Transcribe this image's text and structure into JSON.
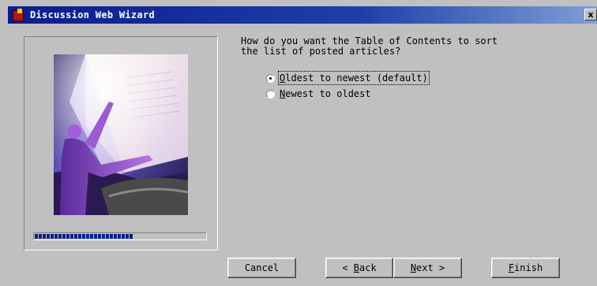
{
  "window": {
    "title": "Discussion Web Wizard",
    "close_label": "x"
  },
  "colors": {
    "titlebar_start": "#0b1c8c",
    "titlebar_end": "#7f9fd6",
    "face": "#c0c0c0",
    "progress": "#0a1e8c"
  },
  "progress": {
    "value": 0.58
  },
  "question": {
    "line1": "How do you want the Table of Contents to sort",
    "line2": "the list of posted articles?"
  },
  "options": [
    {
      "label_first": "O",
      "label_rest": "ldest to newest (default)",
      "checked": true
    },
    {
      "label_first": "N",
      "label_rest": "ewest to oldest",
      "checked": false
    }
  ],
  "buttons": {
    "cancel": "Cancel",
    "back_prefix": "< ",
    "back_key": "B",
    "back_rest": "ack",
    "next_key": "N",
    "next_rest": "ext >",
    "finish_key": "F",
    "finish_rest": "inish"
  },
  "icons": {
    "app": "wizard-app-icon",
    "illustration": "person-reaching-book-illustration"
  }
}
